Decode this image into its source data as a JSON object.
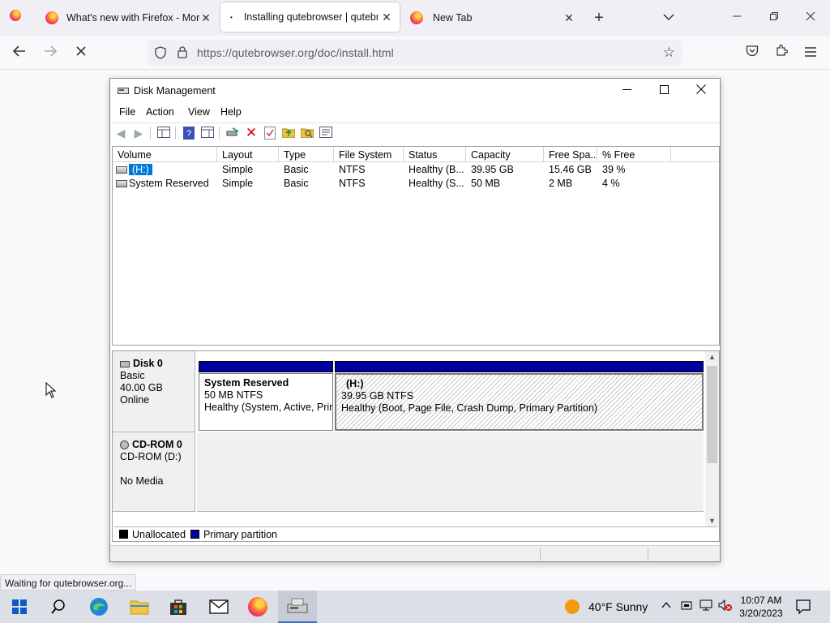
{
  "browser": {
    "tabs": [
      {
        "title": "What's new with Firefox - More",
        "active": false
      },
      {
        "title": "Installing qutebrowser | qutebr",
        "active": true
      },
      {
        "title": "New Tab",
        "active": false
      }
    ],
    "url": "https://qutebrowser.org/doc/install.html",
    "status_text": "Waiting for qutebrowser.org..."
  },
  "disk_management": {
    "title": "Disk Management",
    "menu": [
      "File",
      "Action",
      "View",
      "Help"
    ],
    "columns": [
      "Volume",
      "Layout",
      "Type",
      "File System",
      "Status",
      "Capacity",
      "Free Spa...",
      "% Free"
    ],
    "rows": [
      {
        "volume": "(H:)",
        "layout": "Simple",
        "type": "Basic",
        "fs": "NTFS",
        "status": "Healthy (B...",
        "capacity": "39.95 GB",
        "free": "15.46 GB",
        "pct": "39 %",
        "selected": true
      },
      {
        "volume": "System Reserved",
        "layout": "Simple",
        "type": "Basic",
        "fs": "NTFS",
        "status": "Healthy (S...",
        "capacity": "50 MB",
        "free": "2 MB",
        "pct": "4 %",
        "selected": false
      }
    ],
    "disk0": {
      "name": "Disk 0",
      "type": "Basic",
      "size": "40.00 GB",
      "state": "Online",
      "partitions": [
        {
          "name": "System Reserved",
          "size": "50 MB NTFS",
          "status": "Healthy (System, Active, Prin"
        },
        {
          "name": "(H:)",
          "size": "39.95 GB NTFS",
          "status": "Healthy (Boot, Page File, Crash Dump, Primary Partition)"
        }
      ]
    },
    "cdrom0": {
      "name": "CD-ROM 0",
      "drive": "CD-ROM (D:)",
      "media": "No Media"
    },
    "legend": [
      {
        "label": "Unallocated",
        "color": "#000000"
      },
      {
        "label": "Primary partition",
        "color": "#0000a0"
      }
    ]
  },
  "taskbar": {
    "weather": "40°F  Sunny",
    "time": "10:07 AM",
    "date": "3/20/2023"
  }
}
